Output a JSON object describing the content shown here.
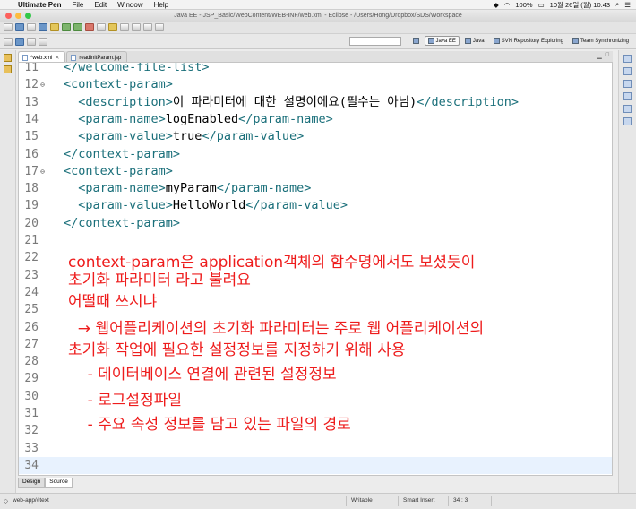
{
  "menubar": {
    "app_name": "Ultimate Pen",
    "items": [
      "File",
      "Edit",
      "Window",
      "Help"
    ],
    "battery": "100%",
    "datetime": "10월 26일 (월)  10:43"
  },
  "window": {
    "title": "Java EE - JSP_Basic/WebContent/WEB-INF/web.xml - Eclipse - /Users/Hong/Dropbox/SDS/Workspace"
  },
  "perspectives": [
    {
      "label": "Java EE",
      "active": true
    },
    {
      "label": "Java",
      "active": false
    },
    {
      "label": "SVN Repository Exploring",
      "active": false
    },
    {
      "label": "Team Synchronizing",
      "active": false
    }
  ],
  "editor_tabs": [
    {
      "label": "*web.xml",
      "active": true
    },
    {
      "label": "readInitParam.jsp",
      "active": false
    }
  ],
  "code_lines": [
    {
      "num": "11",
      "fold": "",
      "parts": [
        {
          "t": "tag",
          "s": "</welcome-file-list>"
        }
      ]
    },
    {
      "num": "12",
      "fold": "⊖",
      "parts": [
        {
          "t": "tag",
          "s": "<context-param>"
        }
      ]
    },
    {
      "num": "13",
      "fold": "",
      "parts": [
        {
          "t": "tag",
          "s": "  <description>"
        },
        {
          "t": "txt",
          "s": "이 파라미터에 대한 설명이에요(필수는 아님)"
        },
        {
          "t": "tag",
          "s": "</description>"
        }
      ]
    },
    {
      "num": "14",
      "fold": "",
      "parts": [
        {
          "t": "tag",
          "s": "  <param-name>"
        },
        {
          "t": "txt",
          "s": "logEnabled"
        },
        {
          "t": "tag",
          "s": "</param-name>"
        }
      ]
    },
    {
      "num": "15",
      "fold": "",
      "parts": [
        {
          "t": "tag",
          "s": "  <param-value>"
        },
        {
          "t": "txt",
          "s": "true"
        },
        {
          "t": "tag",
          "s": "</param-value>"
        }
      ]
    },
    {
      "num": "16",
      "fold": "",
      "parts": [
        {
          "t": "tag",
          "s": "</context-param>"
        }
      ]
    },
    {
      "num": "17",
      "fold": "⊖",
      "parts": [
        {
          "t": "tag",
          "s": "<context-param>"
        }
      ]
    },
    {
      "num": "18",
      "fold": "",
      "parts": [
        {
          "t": "tag",
          "s": "  <param-name>"
        },
        {
          "t": "txt",
          "s": "myParam"
        },
        {
          "t": "tag",
          "s": "</param-name>"
        }
      ]
    },
    {
      "num": "19",
      "fold": "",
      "parts": [
        {
          "t": "tag",
          "s": "  <param-value>"
        },
        {
          "t": "txt",
          "s": "HelloWorld"
        },
        {
          "t": "tag",
          "s": "</param-value>"
        }
      ]
    },
    {
      "num": "20",
      "fold": "",
      "parts": [
        {
          "t": "tag",
          "s": "</context-param>"
        }
      ]
    },
    {
      "num": "21",
      "fold": "",
      "parts": []
    },
    {
      "num": "22",
      "fold": "",
      "parts": []
    },
    {
      "num": "23",
      "fold": "",
      "parts": []
    },
    {
      "num": "24",
      "fold": "",
      "parts": []
    },
    {
      "num": "25",
      "fold": "",
      "parts": []
    },
    {
      "num": "26",
      "fold": "",
      "parts": []
    },
    {
      "num": "27",
      "fold": "",
      "parts": []
    },
    {
      "num": "28",
      "fold": "",
      "parts": []
    },
    {
      "num": "29",
      "fold": "",
      "parts": []
    },
    {
      "num": "30",
      "fold": "",
      "parts": []
    },
    {
      "num": "31",
      "fold": "",
      "parts": []
    },
    {
      "num": "32",
      "fold": "",
      "parts": []
    },
    {
      "num": "33",
      "fold": "",
      "parts": []
    },
    {
      "num": "34",
      "fold": "",
      "parts": []
    }
  ],
  "annotation": {
    "color": "#ee1c1c",
    "lines": [
      "context-param은 application객체의 함수명에서도 보셨듯이",
      "초기화 파라미터 라고 불려요",
      "어떨때 쓰시냐",
      "  → 웹어플리케이션의 초기화 파라미터는 주로 웹 어플리케이션의",
      "초기화 작업에 필요한 설정정보를 지정하기 위해 사용",
      "    - 데이터베이스 연결에 관련된 설정정보",
      "    - 로그설정파일",
      "    - 주요 속성 정보를 담고 있는 파일의 경로"
    ]
  },
  "bottom_tabs": [
    {
      "label": "Design",
      "active": false
    },
    {
      "label": "Source",
      "active": true
    }
  ],
  "status": {
    "path": "web-app/#text",
    "mode": "Writable",
    "insert": "Smart Insert",
    "position": "34 : 3"
  }
}
